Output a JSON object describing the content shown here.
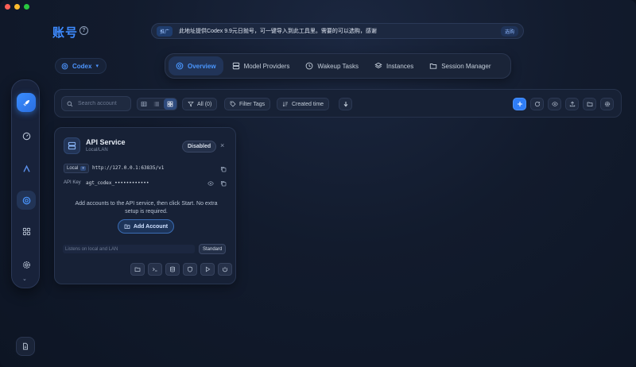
{
  "header": {
    "title": "账号",
    "help_icon": "question-circle-icon",
    "announcement": {
      "badge": "推广",
      "text": "此地址提供Codex 9.9元日抛号，可一键导入到此工具里。需要的可以选购，感谢",
      "button": "选购"
    },
    "platform_select": {
      "value": "Codex",
      "icon": "openai-icon"
    }
  },
  "tabs": [
    {
      "label": "Overview",
      "icon": "openai-icon",
      "active": true
    },
    {
      "label": "Model Providers",
      "icon": "server-icon",
      "active": false
    },
    {
      "label": "Wakeup Tasks",
      "icon": "clock-icon",
      "active": false
    },
    {
      "label": "Instances",
      "icon": "layers-icon",
      "active": false
    },
    {
      "label": "Session Manager",
      "icon": "folder-icon",
      "active": false
    }
  ],
  "sidebar": {
    "items": [
      {
        "icon": "rocket-icon",
        "style": "primary"
      },
      {
        "icon": "gauge-icon",
        "style": "plain"
      },
      {
        "icon": "antigravity-icon",
        "style": "plain"
      },
      {
        "icon": "openai-icon",
        "style": "selected"
      },
      {
        "icon": "grid-icon",
        "style": "plain"
      },
      {
        "icon": "gear-icon",
        "style": "plain"
      }
    ],
    "more_icon": "chevron-down-icon",
    "footer_icon": "document-icon"
  },
  "toolbar": {
    "search_placeholder": "Search account",
    "view_modes": [
      "table",
      "list",
      "grid"
    ],
    "active_view": "grid",
    "filter_all_label": "All (0)",
    "filter_tags_label": "Filter Tags",
    "sort_label": "Created time",
    "right_icons": [
      "plus-icon",
      "refresh-icon",
      "eye-icon",
      "upload-icon",
      "folder-icon",
      "gear-icon"
    ]
  },
  "service_card": {
    "title": "API Service",
    "subtitle": "Local/LAN",
    "status": "Disabled",
    "scope": "Local",
    "url": "http://127.0.0.1:63835/v1",
    "api_key_label": "API Key",
    "api_key_value": "agt_codex_••••••••••••",
    "empty_message": "Add accounts to the API service, then click Start. No extra setup is required.",
    "add_button": "Add Account",
    "listen_placeholder": "Listens on local and LAN",
    "mode": "Standard",
    "action_icons": [
      "folder-icon",
      "terminal-icon",
      "database-icon",
      "shield-icon",
      "play-icon",
      "power-icon"
    ]
  },
  "colors": {
    "accent": "#3e8bff",
    "background": "#121b2d",
    "card": "#172136"
  }
}
